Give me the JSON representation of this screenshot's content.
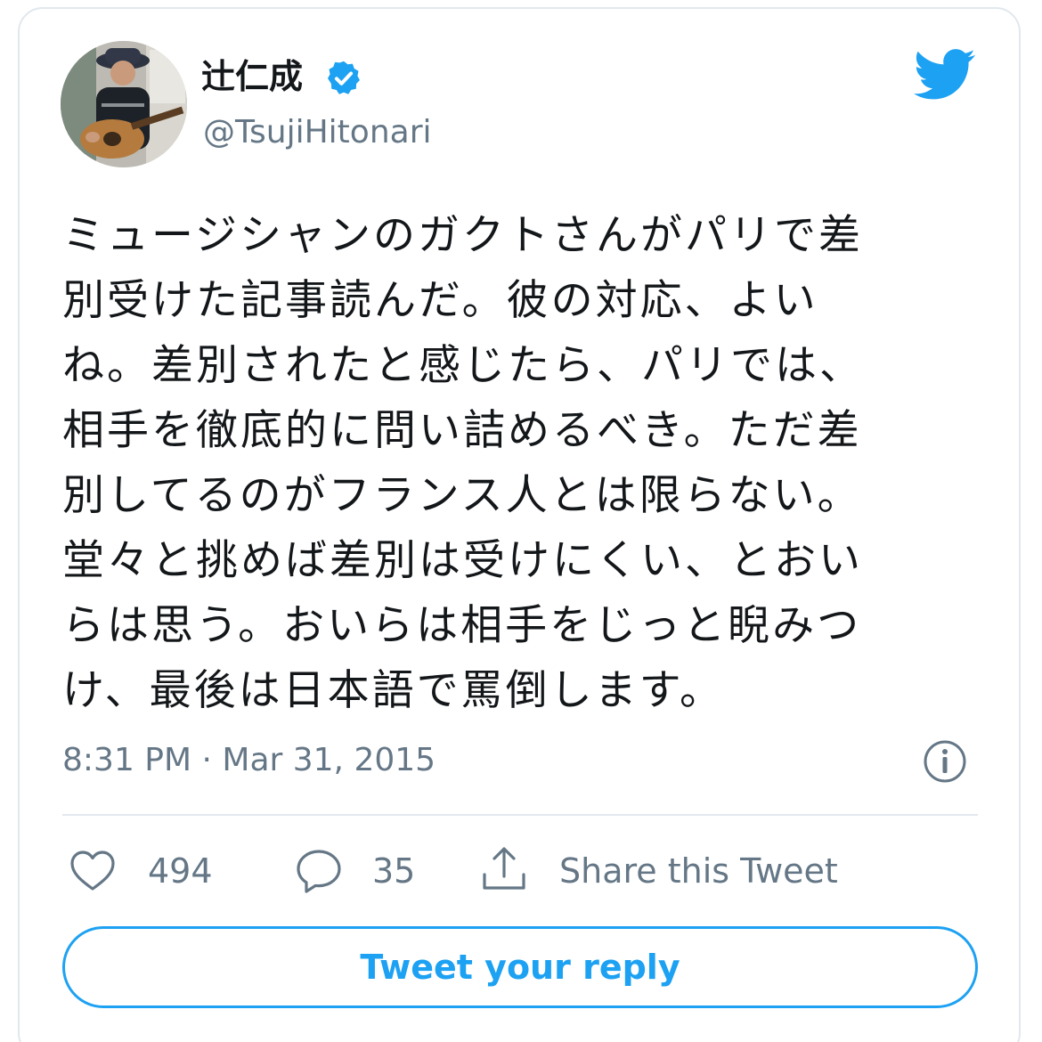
{
  "author": {
    "display_name": "辻仁成",
    "handle": "@TsujiHitonari",
    "verified": true,
    "avatar_icon": "user-avatar-photo"
  },
  "tweet": {
    "text": "ミュージシャンのガクトさんがパリで差\n別受けた記事読んだ。彼の対応、よい\nね。差別されたと感じたら、パリでは、\n相手を徹底的に問い詰めるべき。ただ差\n別してるのがフランス人とは限らない。\n堂々と挑めば差別は受けにくい、とおい\nらは思う。おいらは相手をじっと睨みつ\nけ、最後は日本語で罵倒します。",
    "timestamp": "8:31 PM · Mar 31, 2015"
  },
  "actions": {
    "likes": "494",
    "replies": "35",
    "share_label": "Share this Tweet"
  },
  "reply_button": {
    "label": "Tweet your reply"
  },
  "colors": {
    "accent": "#1da1f2",
    "secondary_text": "#657786",
    "border": "#e1e8ed"
  },
  "icons": {
    "brand": "twitter-bird-icon",
    "verified": "verified-badge-icon",
    "info": "info-icon",
    "like": "heart-icon",
    "reply": "reply-bubble-icon",
    "share": "share-icon"
  }
}
